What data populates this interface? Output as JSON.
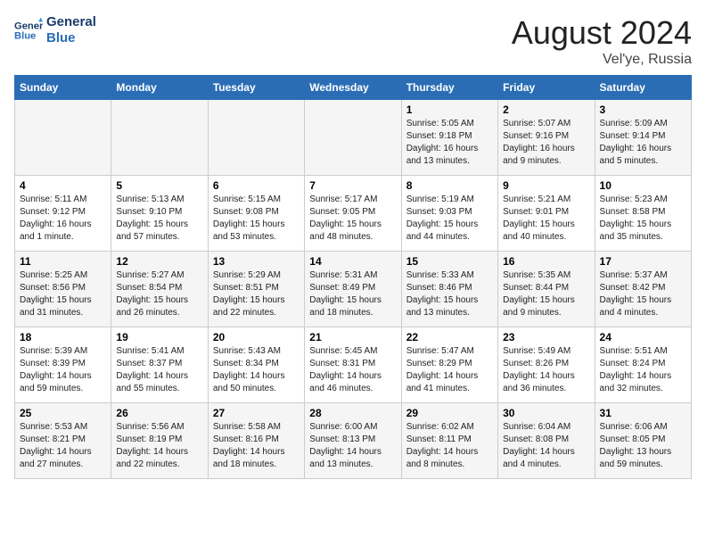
{
  "header": {
    "logo_line1": "General",
    "logo_line2": "Blue",
    "month": "August 2024",
    "location": "Vel'ye, Russia"
  },
  "weekdays": [
    "Sunday",
    "Monday",
    "Tuesday",
    "Wednesday",
    "Thursday",
    "Friday",
    "Saturday"
  ],
  "weeks": [
    [
      {
        "day": "",
        "info": ""
      },
      {
        "day": "",
        "info": ""
      },
      {
        "day": "",
        "info": ""
      },
      {
        "day": "",
        "info": ""
      },
      {
        "day": "1",
        "info": "Sunrise: 5:05 AM\nSunset: 9:18 PM\nDaylight: 16 hours\nand 13 minutes."
      },
      {
        "day": "2",
        "info": "Sunrise: 5:07 AM\nSunset: 9:16 PM\nDaylight: 16 hours\nand 9 minutes."
      },
      {
        "day": "3",
        "info": "Sunrise: 5:09 AM\nSunset: 9:14 PM\nDaylight: 16 hours\nand 5 minutes."
      }
    ],
    [
      {
        "day": "4",
        "info": "Sunrise: 5:11 AM\nSunset: 9:12 PM\nDaylight: 16 hours\nand 1 minute."
      },
      {
        "day": "5",
        "info": "Sunrise: 5:13 AM\nSunset: 9:10 PM\nDaylight: 15 hours\nand 57 minutes."
      },
      {
        "day": "6",
        "info": "Sunrise: 5:15 AM\nSunset: 9:08 PM\nDaylight: 15 hours\nand 53 minutes."
      },
      {
        "day": "7",
        "info": "Sunrise: 5:17 AM\nSunset: 9:05 PM\nDaylight: 15 hours\nand 48 minutes."
      },
      {
        "day": "8",
        "info": "Sunrise: 5:19 AM\nSunset: 9:03 PM\nDaylight: 15 hours\nand 44 minutes."
      },
      {
        "day": "9",
        "info": "Sunrise: 5:21 AM\nSunset: 9:01 PM\nDaylight: 15 hours\nand 40 minutes."
      },
      {
        "day": "10",
        "info": "Sunrise: 5:23 AM\nSunset: 8:58 PM\nDaylight: 15 hours\nand 35 minutes."
      }
    ],
    [
      {
        "day": "11",
        "info": "Sunrise: 5:25 AM\nSunset: 8:56 PM\nDaylight: 15 hours\nand 31 minutes."
      },
      {
        "day": "12",
        "info": "Sunrise: 5:27 AM\nSunset: 8:54 PM\nDaylight: 15 hours\nand 26 minutes."
      },
      {
        "day": "13",
        "info": "Sunrise: 5:29 AM\nSunset: 8:51 PM\nDaylight: 15 hours\nand 22 minutes."
      },
      {
        "day": "14",
        "info": "Sunrise: 5:31 AM\nSunset: 8:49 PM\nDaylight: 15 hours\nand 18 minutes."
      },
      {
        "day": "15",
        "info": "Sunrise: 5:33 AM\nSunset: 8:46 PM\nDaylight: 15 hours\nand 13 minutes."
      },
      {
        "day": "16",
        "info": "Sunrise: 5:35 AM\nSunset: 8:44 PM\nDaylight: 15 hours\nand 9 minutes."
      },
      {
        "day": "17",
        "info": "Sunrise: 5:37 AM\nSunset: 8:42 PM\nDaylight: 15 hours\nand 4 minutes."
      }
    ],
    [
      {
        "day": "18",
        "info": "Sunrise: 5:39 AM\nSunset: 8:39 PM\nDaylight: 14 hours\nand 59 minutes."
      },
      {
        "day": "19",
        "info": "Sunrise: 5:41 AM\nSunset: 8:37 PM\nDaylight: 14 hours\nand 55 minutes."
      },
      {
        "day": "20",
        "info": "Sunrise: 5:43 AM\nSunset: 8:34 PM\nDaylight: 14 hours\nand 50 minutes."
      },
      {
        "day": "21",
        "info": "Sunrise: 5:45 AM\nSunset: 8:31 PM\nDaylight: 14 hours\nand 46 minutes."
      },
      {
        "day": "22",
        "info": "Sunrise: 5:47 AM\nSunset: 8:29 PM\nDaylight: 14 hours\nand 41 minutes."
      },
      {
        "day": "23",
        "info": "Sunrise: 5:49 AM\nSunset: 8:26 PM\nDaylight: 14 hours\nand 36 minutes."
      },
      {
        "day": "24",
        "info": "Sunrise: 5:51 AM\nSunset: 8:24 PM\nDaylight: 14 hours\nand 32 minutes."
      }
    ],
    [
      {
        "day": "25",
        "info": "Sunrise: 5:53 AM\nSunset: 8:21 PM\nDaylight: 14 hours\nand 27 minutes."
      },
      {
        "day": "26",
        "info": "Sunrise: 5:56 AM\nSunset: 8:19 PM\nDaylight: 14 hours\nand 22 minutes."
      },
      {
        "day": "27",
        "info": "Sunrise: 5:58 AM\nSunset: 8:16 PM\nDaylight: 14 hours\nand 18 minutes."
      },
      {
        "day": "28",
        "info": "Sunrise: 6:00 AM\nSunset: 8:13 PM\nDaylight: 14 hours\nand 13 minutes."
      },
      {
        "day": "29",
        "info": "Sunrise: 6:02 AM\nSunset: 8:11 PM\nDaylight: 14 hours\nand 8 minutes."
      },
      {
        "day": "30",
        "info": "Sunrise: 6:04 AM\nSunset: 8:08 PM\nDaylight: 14 hours\nand 4 minutes."
      },
      {
        "day": "31",
        "info": "Sunrise: 6:06 AM\nSunset: 8:05 PM\nDaylight: 13 hours\nand 59 minutes."
      }
    ]
  ]
}
